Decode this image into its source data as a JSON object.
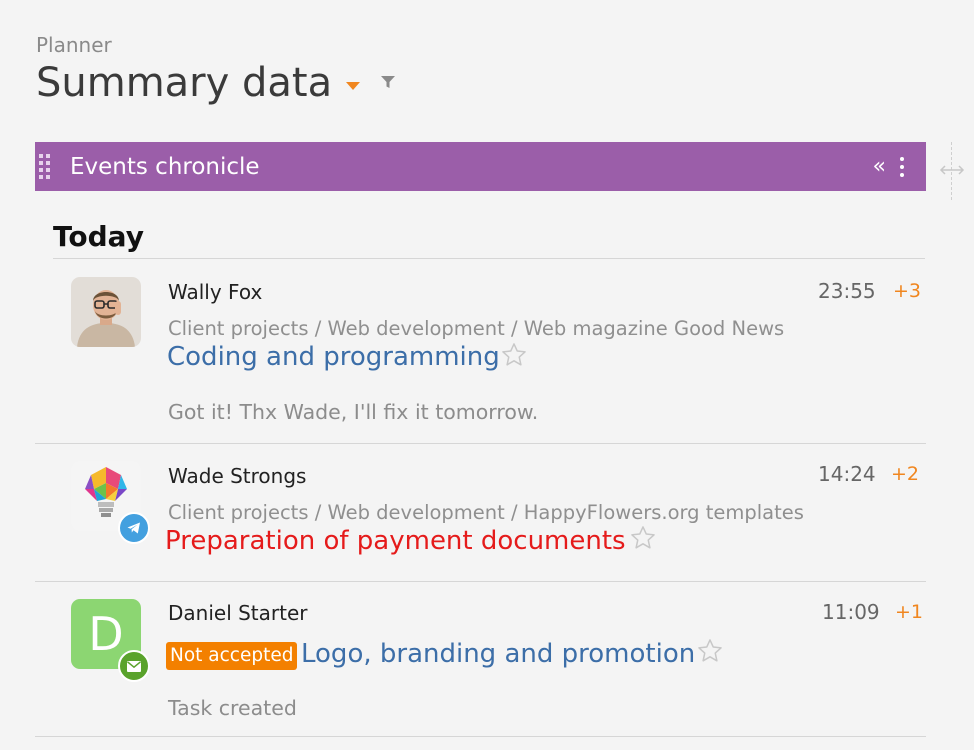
{
  "header": {
    "breadcrumb": "Planner",
    "title": "Summary data"
  },
  "panel": {
    "title": "Events chronicle",
    "collapse_label": "«",
    "color": "#9b5ea9"
  },
  "section": {
    "title": "Today"
  },
  "events": [
    {
      "author": "Wally Fox",
      "time": "23:55",
      "more": "+3",
      "path": "Client projects / Web development / Web magazine Good News",
      "task": "Coding and programming",
      "task_color": "#3c6ea8",
      "note": "Got it! Thx Wade, I'll fix it tomorrow.",
      "avatar": "photo-avatar"
    },
    {
      "author": "Wade Strongs",
      "time": "14:24",
      "more": "+2",
      "path": "Client projects / Web development / HappyFlowers.org templates",
      "task": "Preparation of payment documents",
      "task_color": "#e51b1b",
      "avatar": "lightbulb-avatar",
      "channel_icon": "telegram-icon"
    },
    {
      "author": "Daniel Starter",
      "time": "11:09",
      "more": "+1",
      "status": "Not accepted",
      "task": "Logo, branding and promotion",
      "task_color": "#3c6ea8",
      "note": "Task created",
      "avatar_letter": "D",
      "channel_icon": "email-icon"
    }
  ],
  "colors": {
    "accent_orange": "#f0861f",
    "status_orange": "#f38000",
    "link_blue": "#3c6ea8",
    "alert_red": "#e51b1b"
  }
}
